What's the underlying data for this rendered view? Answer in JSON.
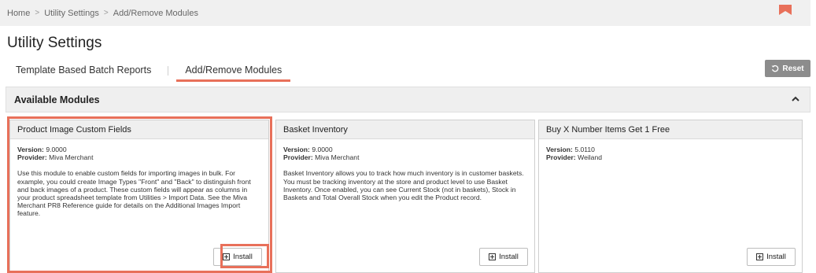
{
  "breadcrumb": {
    "items": [
      "Home",
      "Utility Settings",
      "Add/Remove Modules"
    ],
    "separator": ">"
  },
  "page": {
    "title": "Utility Settings"
  },
  "tabs": [
    {
      "label": "Template Based Batch Reports",
      "active": false
    },
    {
      "label": "Add/Remove Modules",
      "active": true
    }
  ],
  "toolbar": {
    "reset_label": "Reset"
  },
  "section": {
    "title": "Available Modules",
    "collapse_icon": "chevron-up-icon"
  },
  "cards": [
    {
      "title": "Product Image Custom Fields",
      "version_label": "Version:",
      "version": "9.0000",
      "provider_label": "Provider:",
      "provider": "Miva Merchant",
      "description": "Use this module to enable custom fields for importing images in bulk. For example, you could create Image Types \"Front\" and \"Back\" to distinguish front and back images of a product. These custom fields will appear as columns in your product spreadsheet template from Utilities > Import Data. See the Miva Merchant PR8 Reference guide for details on the Additional Images Import feature.",
      "install_label": "Install",
      "highlighted": true
    },
    {
      "title": "Basket Inventory",
      "version_label": "Version:",
      "version": "9.0000",
      "provider_label": "Provider:",
      "provider": "Miva Merchant",
      "description": "Basket Inventory allows you to track how much inventory is in customer baskets. You must be tracking inventory at the store and product level to use Basket Inventory. Once enabled, you can see Current Stock (not in baskets), Stock in Baskets and Total Overall Stock when you edit the Product record.",
      "install_label": "Install",
      "highlighted": false
    },
    {
      "title": "Buy X Number Items Get 1 Free",
      "version_label": "Version:",
      "version": "5.0110",
      "provider_label": "Provider:",
      "provider": "Weiland",
      "description": "",
      "install_label": "Install",
      "highlighted": false
    }
  ],
  "colors": {
    "accent": "#e8705a",
    "reset_bg": "#8c8c8c",
    "header_bg": "#efefef"
  }
}
